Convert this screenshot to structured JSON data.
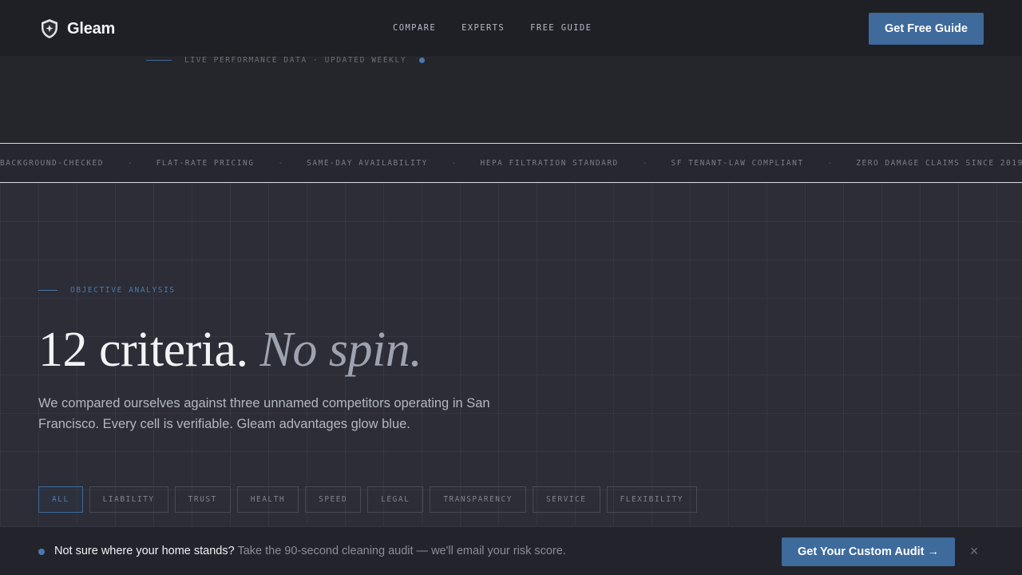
{
  "header": {
    "brand": "Gleam",
    "nav": [
      {
        "label": "COMPARE"
      },
      {
        "label": "EXPERTS"
      },
      {
        "label": "FREE GUIDE"
      }
    ],
    "cta_label": "Get Free Guide"
  },
  "live_strip": {
    "text": "LIVE PERFORMANCE DATA · UPDATED WEEKLY"
  },
  "marquee": {
    "items": [
      "BACKGROUND-CHECKED",
      "FLAT-RATE PRICING",
      "SAME-DAY AVAILABILITY",
      "HEPA FILTRATION STANDARD",
      "SF TENANT-LAW COMPLIANT",
      "ZERO DAMAGE CLAIMS SINCE 2019"
    ],
    "separator": "-"
  },
  "hero": {
    "eyebrow": "OBJECTIVE ANALYSIS",
    "title_main": "12 criteria.",
    "title_accent": "No spin.",
    "subtitle": "We compared ourselves against three unnamed competitors operating in San Francisco. Every cell is verifiable. Gleam advantages glow blue."
  },
  "filters": [
    {
      "label": "ALL",
      "active": true
    },
    {
      "label": "LIABILITY",
      "active": false
    },
    {
      "label": "TRUST",
      "active": false
    },
    {
      "label": "HEALTH",
      "active": false
    },
    {
      "label": "SPEED",
      "active": false
    },
    {
      "label": "LEGAL",
      "active": false
    },
    {
      "label": "TRANSPARENCY",
      "active": false
    },
    {
      "label": "SERVICE",
      "active": false
    },
    {
      "label": "FLEXIBILITY",
      "active": false
    }
  ],
  "bottom_bar": {
    "lead": "Not sure where your home stands?",
    "detail": "Take the 90-second cleaning audit — we'll email your risk score.",
    "cta_label": "Get Your Custom Audit →",
    "close_glyph": "×"
  },
  "colors": {
    "accent": "#3e6a9c",
    "background": "#2b2c34",
    "header": "#1e2027"
  },
  "icons": {
    "logo": "shield-sparkle-icon",
    "close": "close-icon"
  }
}
